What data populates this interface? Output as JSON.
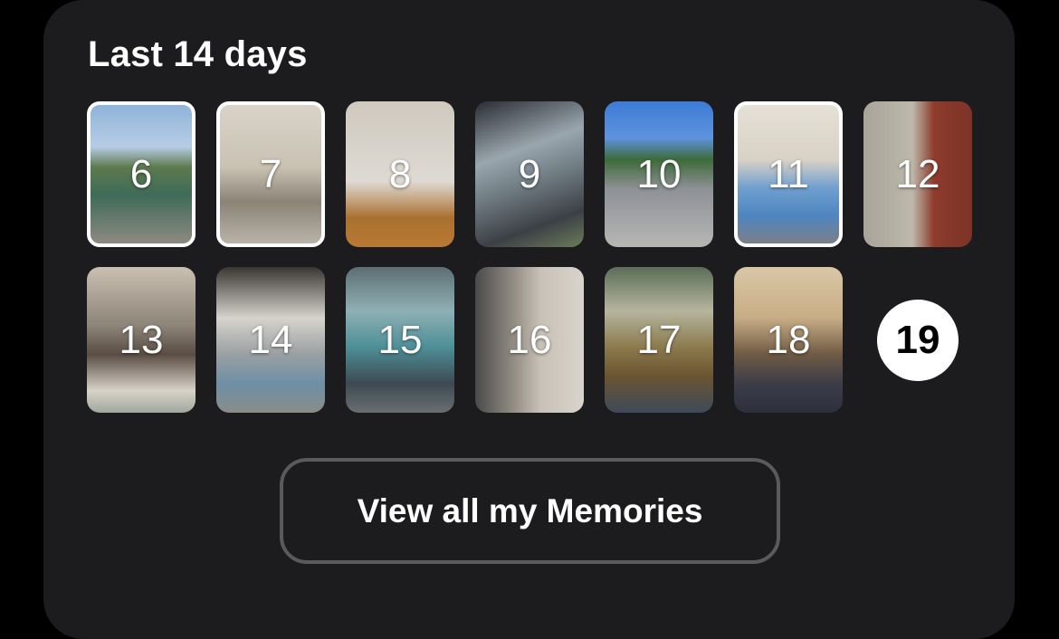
{
  "section": {
    "title": "Last 14 days"
  },
  "days": [
    {
      "label": "6",
      "selected": true
    },
    {
      "label": "7",
      "selected": true
    },
    {
      "label": "8",
      "selected": false
    },
    {
      "label": "9",
      "selected": false
    },
    {
      "label": "10",
      "selected": false
    },
    {
      "label": "11",
      "selected": true
    },
    {
      "label": "12",
      "selected": false
    },
    {
      "label": "13",
      "selected": false
    },
    {
      "label": "14",
      "selected": false
    },
    {
      "label": "15",
      "selected": false
    },
    {
      "label": "16",
      "selected": false
    },
    {
      "label": "17",
      "selected": false
    },
    {
      "label": "18",
      "selected": false
    }
  ],
  "today": {
    "label": "19"
  },
  "button": {
    "label": "View all my Memories"
  },
  "colors": {
    "background": "#000000",
    "card": "#1c1c1e",
    "button_border": "#5a5a5c",
    "text": "#ffffff"
  }
}
